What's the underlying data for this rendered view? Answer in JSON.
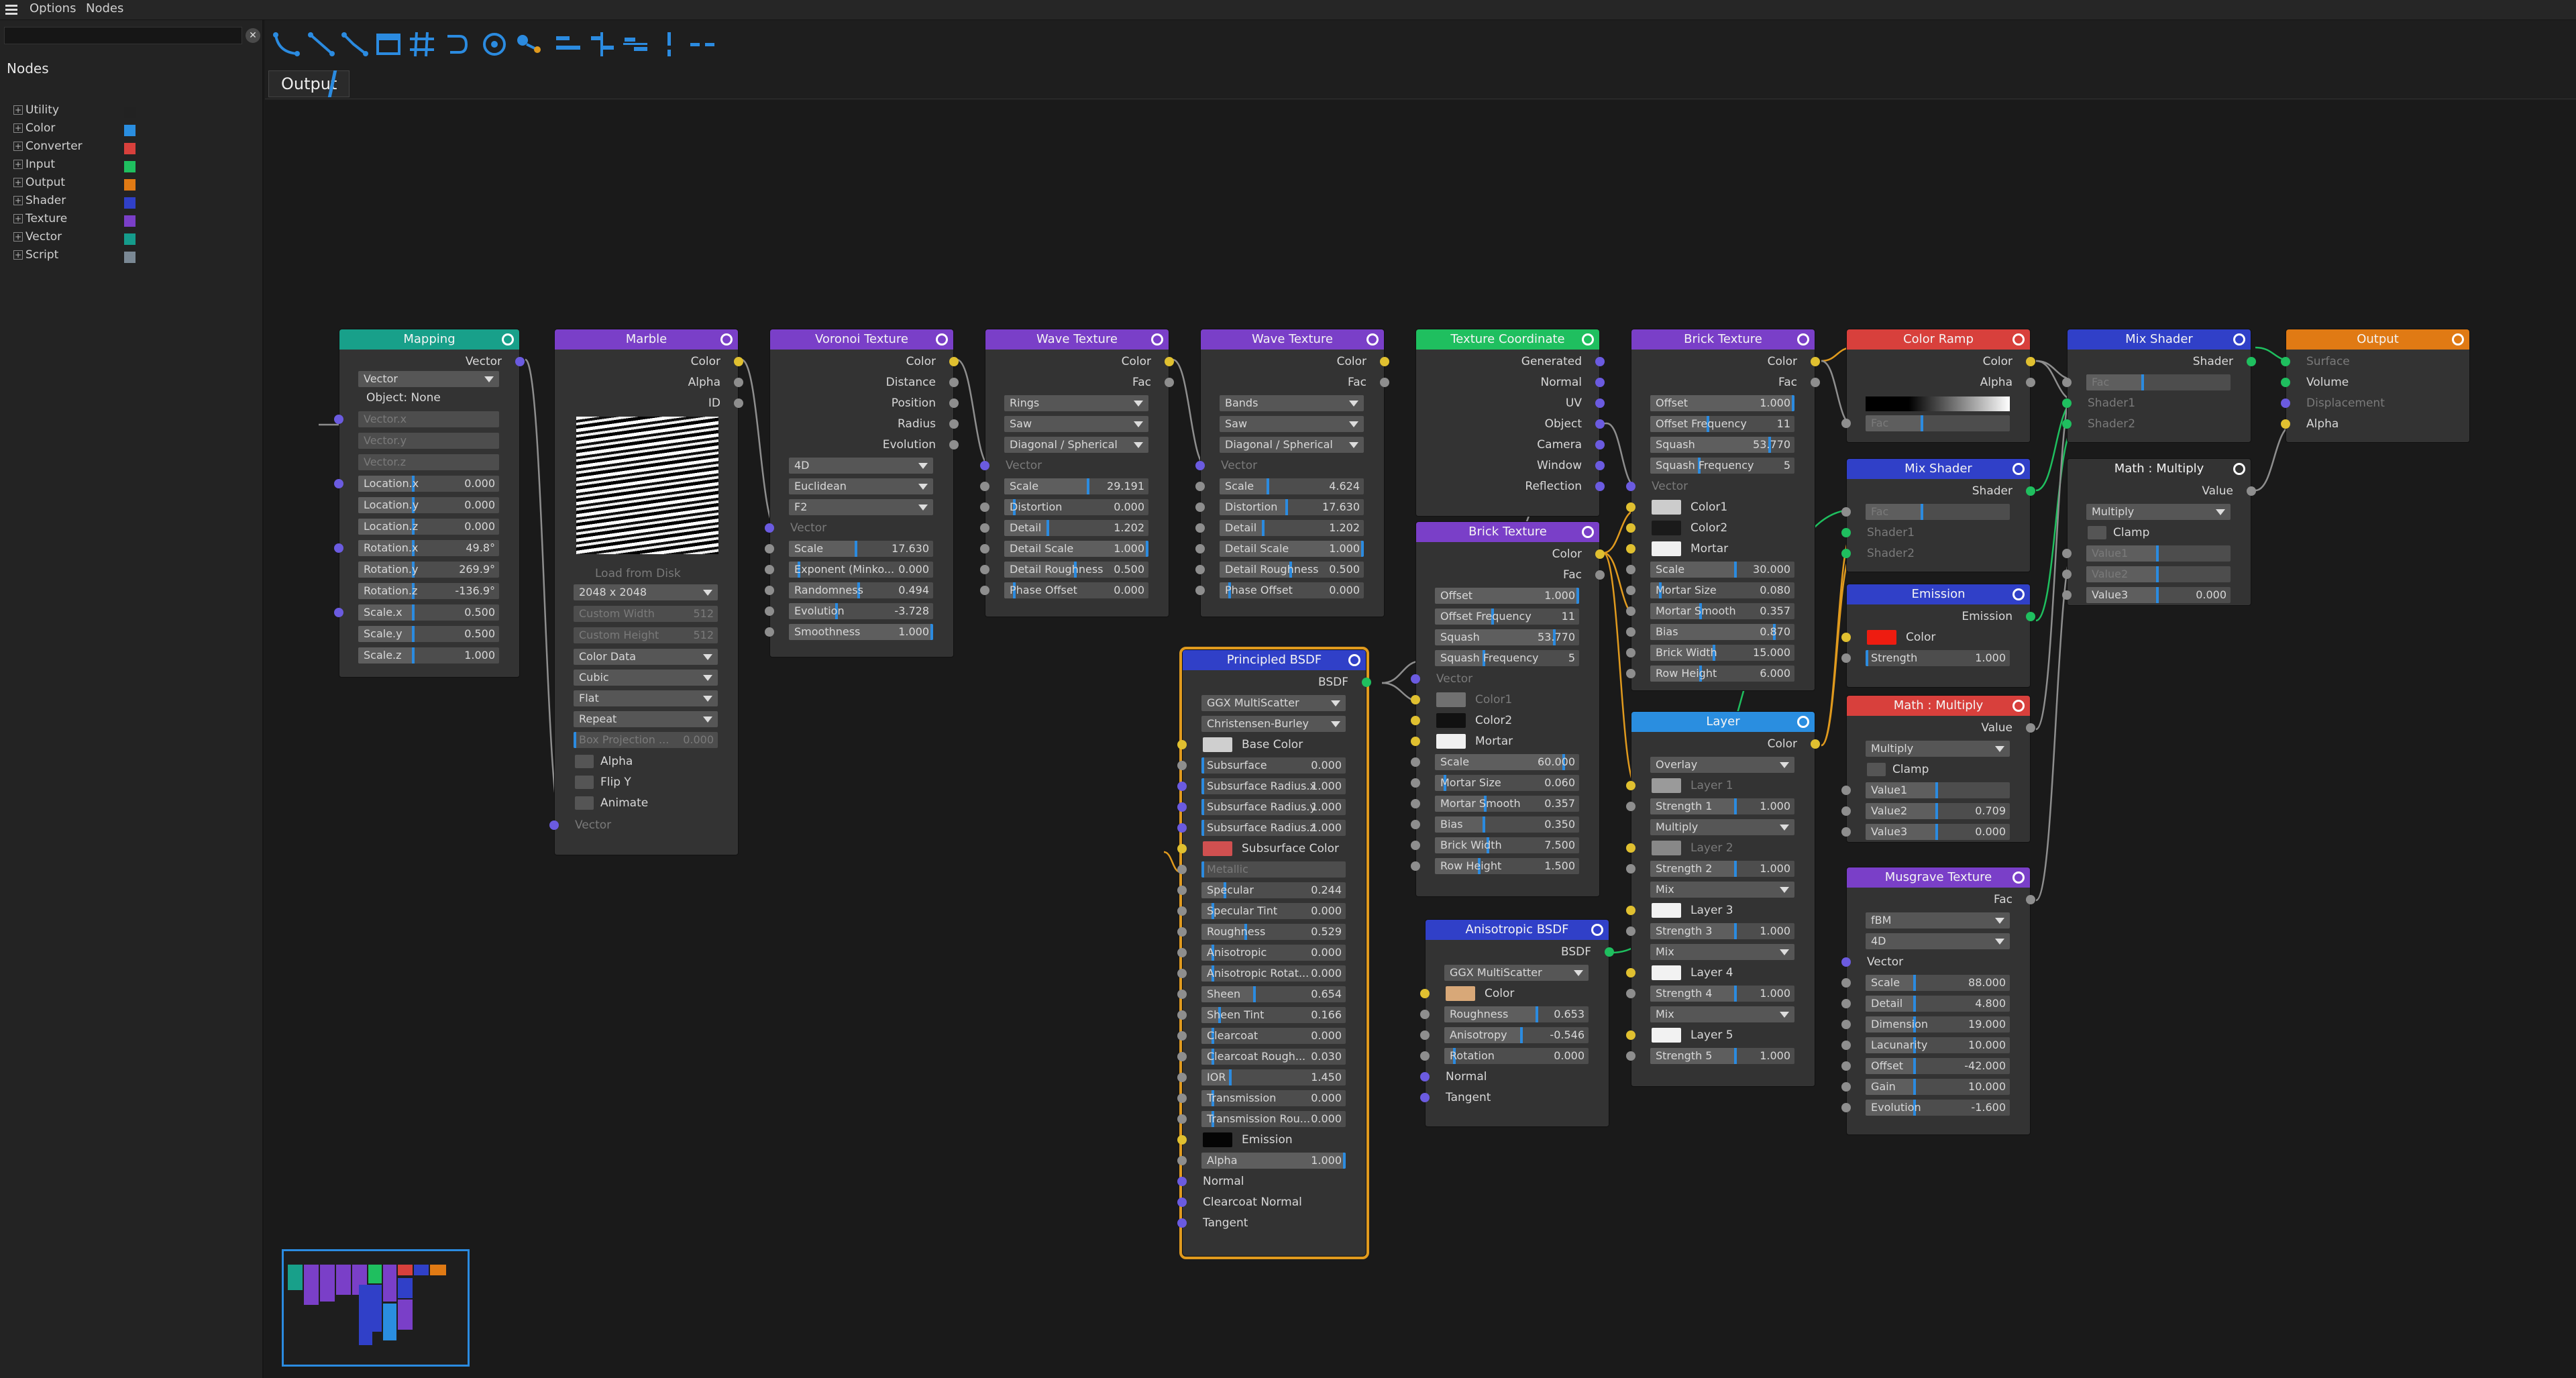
{
  "menu": {
    "options": "Options",
    "nodes": "Nodes"
  },
  "sidebar": {
    "title": "Nodes",
    "close_glyph": "✕",
    "categories": [
      {
        "label": "Utility",
        "color": "#222222"
      },
      {
        "label": "Color",
        "color": "#2a8ee0"
      },
      {
        "label": "Converter",
        "color": "#d8403c"
      },
      {
        "label": "Input",
        "color": "#1fbf5f"
      },
      {
        "label": "Output",
        "color": "#e07a14"
      },
      {
        "label": "Shader",
        "color": "#3040c8"
      },
      {
        "label": "Texture",
        "color": "#7a3fc8"
      },
      {
        "label": "Vector",
        "color": "#159c8c"
      },
      {
        "label": "Script",
        "color": "#7a8894"
      }
    ]
  },
  "toolbar": {
    "icons": [
      "link-curve-icon",
      "link-straight-icon",
      "link-angle-icon",
      "frame-icon",
      "grid-icon",
      "snap-icon",
      "center-icon",
      "node-icon",
      "align-left-icon",
      "align-center-icon",
      "align-right-icon",
      "distribute-v-icon",
      "distribute-h-icon"
    ]
  },
  "tab": {
    "label": "Output"
  },
  "colors": {
    "accent": "#2b8be0",
    "selection": "#e09a1e",
    "input_socket": "#e0c030",
    "shader_socket": "#1fbf5f",
    "vector_socket": "#6b5be0",
    "float_socket": "#8e8e8e"
  },
  "nodes": {
    "mapping": {
      "title": "Mapping",
      "out": "Vector",
      "type": "Vector",
      "object": "Object: None",
      "fields": [
        [
          "Vector.x",
          ""
        ],
        [
          "Vector.y",
          ""
        ],
        [
          "Vector.z",
          ""
        ],
        [
          "Location.x",
          "0.000"
        ],
        [
          "Location.y",
          "0.000"
        ],
        [
          "Location.z",
          "0.000"
        ],
        [
          "Rotation.x",
          "49.8°"
        ],
        [
          "Rotation.y",
          "269.9°"
        ],
        [
          "Rotation.z",
          "-136.9°"
        ],
        [
          "Scale.x",
          "0.500"
        ],
        [
          "Scale.y",
          "0.500"
        ],
        [
          "Scale.z",
          "1.000"
        ]
      ]
    },
    "marble": {
      "title": "Marble",
      "outs": [
        "Color",
        "Alpha",
        "ID"
      ],
      "load": "Load from Disk",
      "res": "2048 x 2048",
      "cw": "Custom Width",
      "cwv": "512",
      "ch": "Custom Height",
      "chv": "512",
      "dds": [
        "Color Data",
        "Cubic",
        "Flat",
        "Repeat"
      ],
      "bp": "Box Projection ...",
      "bpv": "0.000",
      "checks": [
        "Alpha",
        "Flip Y",
        "Animate"
      ],
      "vector": "Vector"
    },
    "voronoi": {
      "title": "Voronoi Texture",
      "outs": [
        "Color",
        "Distance",
        "Position",
        "Radius",
        "Evolution"
      ],
      "dds": [
        "4D",
        "Euclidean",
        "F2"
      ],
      "vector": "Vector",
      "fields": [
        [
          "Scale",
          "17.630"
        ],
        [
          "Exponent (Minko...",
          "0.000"
        ],
        [
          "Randomness",
          "0.494"
        ],
        [
          "Evolution",
          "-3.728"
        ],
        [
          "Smoothness",
          "1.000"
        ]
      ]
    },
    "wave1": {
      "title": "Wave Texture",
      "outs": [
        "Color",
        "Fac"
      ],
      "dds": [
        "Rings",
        "Saw",
        "Diagonal / Spherical"
      ],
      "vector": "Vector",
      "fields": [
        [
          "Scale",
          "29.191"
        ],
        [
          "Distortion",
          "0.000"
        ],
        [
          "Detail",
          "1.202"
        ],
        [
          "Detail Scale",
          "1.000"
        ],
        [
          "Detail Roughness",
          "0.500"
        ],
        [
          "Phase Offset",
          "0.000"
        ]
      ]
    },
    "wave2": {
      "title": "Wave Texture",
      "outs": [
        "Color",
        "Fac"
      ],
      "dds": [
        "Bands",
        "Saw",
        "Diagonal / Spherical"
      ],
      "vector": "Vector",
      "fields": [
        [
          "Scale",
          "4.624"
        ],
        [
          "Distortion",
          "17.630"
        ],
        [
          "Detail",
          "1.202"
        ],
        [
          "Detail Scale",
          "1.000"
        ],
        [
          "Detail Roughness",
          "0.500"
        ],
        [
          "Phase Offset",
          "0.000"
        ]
      ]
    },
    "texcoord": {
      "title": "Texture Coordinate",
      "outs": [
        "Generated",
        "Normal",
        "UV",
        "Object",
        "Camera",
        "Window",
        "Reflection"
      ]
    },
    "brick1": {
      "title": "Brick Texture",
      "outs": [
        "Color",
        "Fac"
      ],
      "fields": [
        [
          "Offset",
          "1.000"
        ],
        [
          "Offset Frequency",
          "11"
        ],
        [
          "Squash",
          "53.770"
        ],
        [
          "Squash Frequency",
          "5"
        ]
      ],
      "vector": "Vector",
      "colors": [
        [
          "Color1",
          "#cccccc"
        ],
        [
          "Color2",
          "#1a1a1a"
        ],
        [
          "Mortar",
          "#f0f0f0"
        ]
      ],
      "fields2": [
        [
          "Scale",
          "30.000"
        ],
        [
          "Mortar Size",
          "0.080"
        ],
        [
          "Mortar Smooth",
          "0.357"
        ],
        [
          "Bias",
          "0.870"
        ],
        [
          "Brick Width",
          "15.000"
        ],
        [
          "Row Height",
          "6.000"
        ]
      ]
    },
    "brick2": {
      "title": "Brick Texture",
      "outs": [
        "Color",
        "Fac"
      ],
      "fields": [
        [
          "Offset",
          "1.000"
        ],
        [
          "Offset Frequency",
          "11"
        ],
        [
          "Squash",
          "53.770"
        ],
        [
          "Squash Frequency",
          "5"
        ]
      ],
      "vector": "Vector",
      "colors": [
        [
          "Color1",
          "#707070"
        ],
        [
          "Color2",
          "#111111"
        ],
        [
          "Mortar",
          "#f0f0f0"
        ]
      ],
      "fields2": [
        [
          "Scale",
          "60.000"
        ],
        [
          "Mortar Size",
          "0.060"
        ],
        [
          "Mortar Smooth",
          "0.357"
        ],
        [
          "Bias",
          "0.350"
        ],
        [
          "Brick Width",
          "7.500"
        ],
        [
          "Row Height",
          "1.500"
        ]
      ]
    },
    "colorramp": {
      "title": "Color Ramp",
      "outs": [
        "Color",
        "Alpha"
      ],
      "fac": "Fac"
    },
    "mixshader1": {
      "title": "Mix Shader",
      "out": "Shader",
      "ins": [
        "Fac",
        "Shader1",
        "Shader2"
      ]
    },
    "mixshader2": {
      "title": "Mix Shader",
      "out": "Shader",
      "ins": [
        "Fac",
        "Shader1",
        "Shader2"
      ]
    },
    "output": {
      "title": "Output",
      "ins": [
        "Surface",
        "Volume",
        "Displacement",
        "Alpha"
      ]
    },
    "mathmul1": {
      "title": "Math : Multiply",
      "out": "Value",
      "op": "Multiply",
      "clamp": "Clamp",
      "fields": [
        [
          "Value1",
          ""
        ],
        [
          "Value2",
          ""
        ],
        [
          "Value3",
          "0.000"
        ]
      ]
    },
    "emission": {
      "title": "Emission",
      "out": "Emission",
      "color": "Color",
      "strength": "Strength",
      "strengthv": "1.000"
    },
    "mathmul2": {
      "title": "Math : Multiply",
      "out": "Value",
      "op": "Multiply",
      "clamp": "Clamp",
      "fields": [
        [
          "Value1",
          ""
        ],
        [
          "Value2",
          "0.709"
        ],
        [
          "Value3",
          "0.000"
        ]
      ]
    },
    "layer": {
      "title": "Layer",
      "out": "Color",
      "blends": [
        "Overlay",
        "Multiply",
        "Mix",
        "Mix",
        "Mix"
      ],
      "layers": [
        [
          "Layer 1",
          "#9a9a9a"
        ],
        [
          "Layer 2",
          "#888888"
        ],
        [
          "Layer 3",
          "#f2f2f2"
        ],
        [
          "Layer 4",
          "#f2f2f2"
        ],
        [
          "Layer 5",
          "#f2f2f2"
        ]
      ],
      "strengths": [
        [
          "Strength 1",
          "1.000"
        ],
        [
          "Strength 2",
          "1.000"
        ],
        [
          "Strength 3",
          "1.000"
        ],
        [
          "Strength 4",
          "1.000"
        ],
        [
          "Strength 5",
          "1.000"
        ]
      ]
    },
    "musgrave": {
      "title": "Musgrave Texture",
      "out": "Fac",
      "dds": [
        "fBM",
        "4D"
      ],
      "vector": "Vector",
      "fields": [
        [
          "Scale",
          "88.000"
        ],
        [
          "Detail",
          "4.800"
        ],
        [
          "Dimension",
          "19.000"
        ],
        [
          "Lacunarity",
          "10.000"
        ],
        [
          "Offset",
          "-42.000"
        ],
        [
          "Gain",
          "10.000"
        ],
        [
          "Evolution",
          "-1.600"
        ]
      ]
    },
    "aniso": {
      "title": "Anisotropic BSDF",
      "out": "BSDF",
      "dd": "GGX MultiScatter",
      "color": "Color",
      "fields": [
        [
          "Roughness",
          "0.653"
        ],
        [
          "Anisotropy",
          "-0.546"
        ],
        [
          "Rotation",
          "0.000"
        ]
      ],
      "ins": [
        "Normal",
        "Tangent"
      ]
    },
    "principled": {
      "title": "Principled BSDF",
      "out": "BSDF",
      "dds": [
        "GGX MultiScatter",
        "Christensen-Burley"
      ],
      "basecolor": "Base Color",
      "fields1": [
        [
          "Subsurface",
          "0.000"
        ],
        [
          "Subsurface Radius.x",
          "1.000"
        ],
        [
          "Subsurface Radius.y",
          "1.000"
        ],
        [
          "Subsurface Radius.z",
          "1.000"
        ]
      ],
      "sscolor": "Subsurface Color",
      "metallic": "Metallic",
      "fields2": [
        [
          "Specular",
          "0.244"
        ],
        [
          "Specular Tint",
          "0.000"
        ],
        [
          "Roughness",
          "0.529"
        ],
        [
          "Anisotropic",
          "0.000"
        ],
        [
          "Anisotropic Rotat...",
          "0.000"
        ],
        [
          "Sheen",
          "0.654"
        ],
        [
          "Sheen Tint",
          "0.166"
        ],
        [
          "Clearcoat",
          "0.000"
        ],
        [
          "Clearcoat Rough...",
          "0.030"
        ],
        [
          "IOR",
          "1.450"
        ],
        [
          "Transmission",
          "0.000"
        ],
        [
          "Transmission Rou...",
          "0.000"
        ]
      ],
      "emission": "Emission",
      "alpha": "Alpha",
      "alphav": "1.000",
      "ins": [
        "Normal",
        "Clearcoat Normal",
        "Tangent"
      ]
    }
  }
}
